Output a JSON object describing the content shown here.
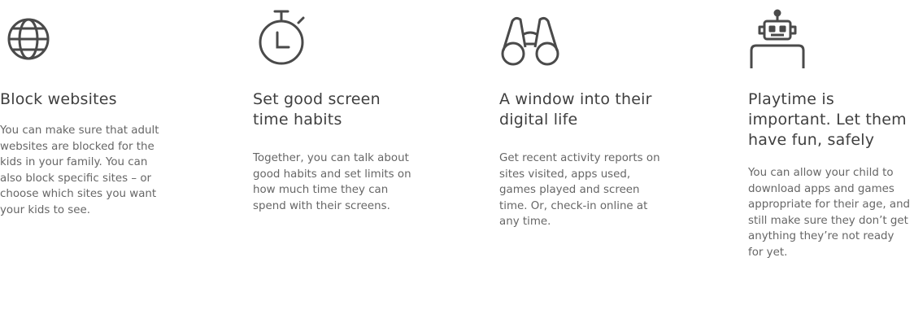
{
  "features": [
    {
      "icon": "globe-icon",
      "title": "Block websites",
      "description": "You can make sure that adult websites are blocked for the kids in your family. You can also block specific sites – or choose which sites you want your kids to see."
    },
    {
      "icon": "stopwatch-icon",
      "title": "Set good screen time habits",
      "description": "Together, you can talk about good habits and set limits on how much time they can spend with their screens."
    },
    {
      "icon": "binoculars-icon",
      "title": "A window into their digital life",
      "description": "Get recent activity reports on sites visited, apps used, games played and screen time. Or, check-in online at any time."
    },
    {
      "icon": "robot-icon",
      "title": "Playtime is important. Let them have fun, safely",
      "description": "You can allow your child to download apps and games appropriate for their age, and still make sure they don’t get anything they’re not ready for yet."
    }
  ],
  "colors": {
    "icon_stroke": "#4a4a4a",
    "title_text": "#3f3f3f",
    "body_text": "#666666",
    "background": "#ffffff"
  }
}
